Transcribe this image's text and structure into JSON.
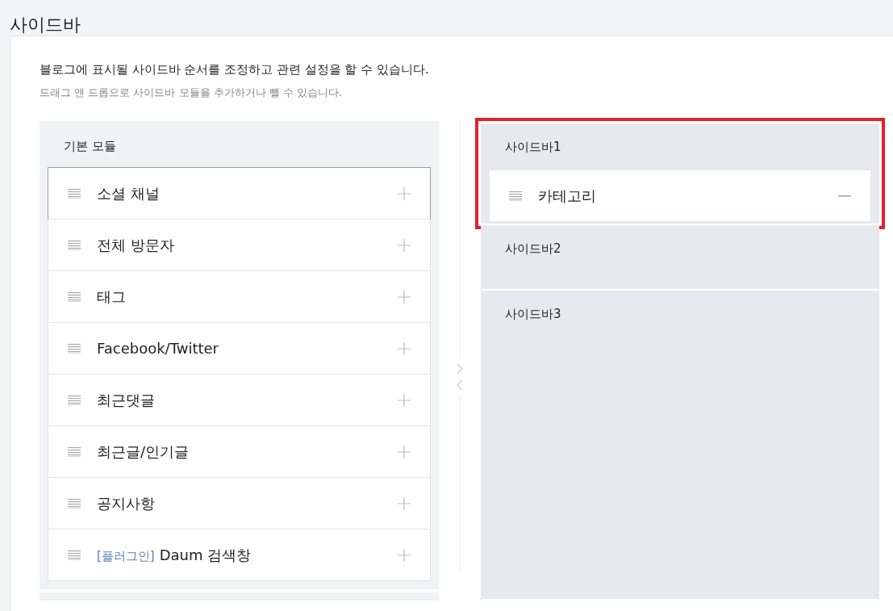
{
  "page": {
    "title": "사이드바"
  },
  "description": {
    "main": "블로그에 표시될 사이드바 순서를 조정하고 관련 설정을 할 수 있습니다.",
    "hint": "드래그 앤 드롭으로 사이드바 모듈을 추가하거나 뺄 수 있습니다."
  },
  "module_panel": {
    "title": "기본 모듈",
    "items": [
      {
        "label": "소셜 채널",
        "selected": true
      },
      {
        "label": "전체 방문자",
        "selected": false
      },
      {
        "label": "태그",
        "selected": false
      },
      {
        "label": "Facebook/Twitter",
        "selected": false
      },
      {
        "label": "최근댓글",
        "selected": false
      },
      {
        "label": "최근글/인기글",
        "selected": false
      },
      {
        "label": "공지사항",
        "selected": false
      },
      {
        "label": "Daum 검색창",
        "tag": "[플러그인]",
        "selected": false
      }
    ]
  },
  "sidebars": [
    {
      "title": "사이드바1",
      "highlighted": true,
      "items": [
        {
          "label": "카테고리"
        }
      ]
    },
    {
      "title": "사이드바2",
      "highlighted": false
    },
    {
      "title": "사이드바3",
      "highlighted": false
    }
  ]
}
